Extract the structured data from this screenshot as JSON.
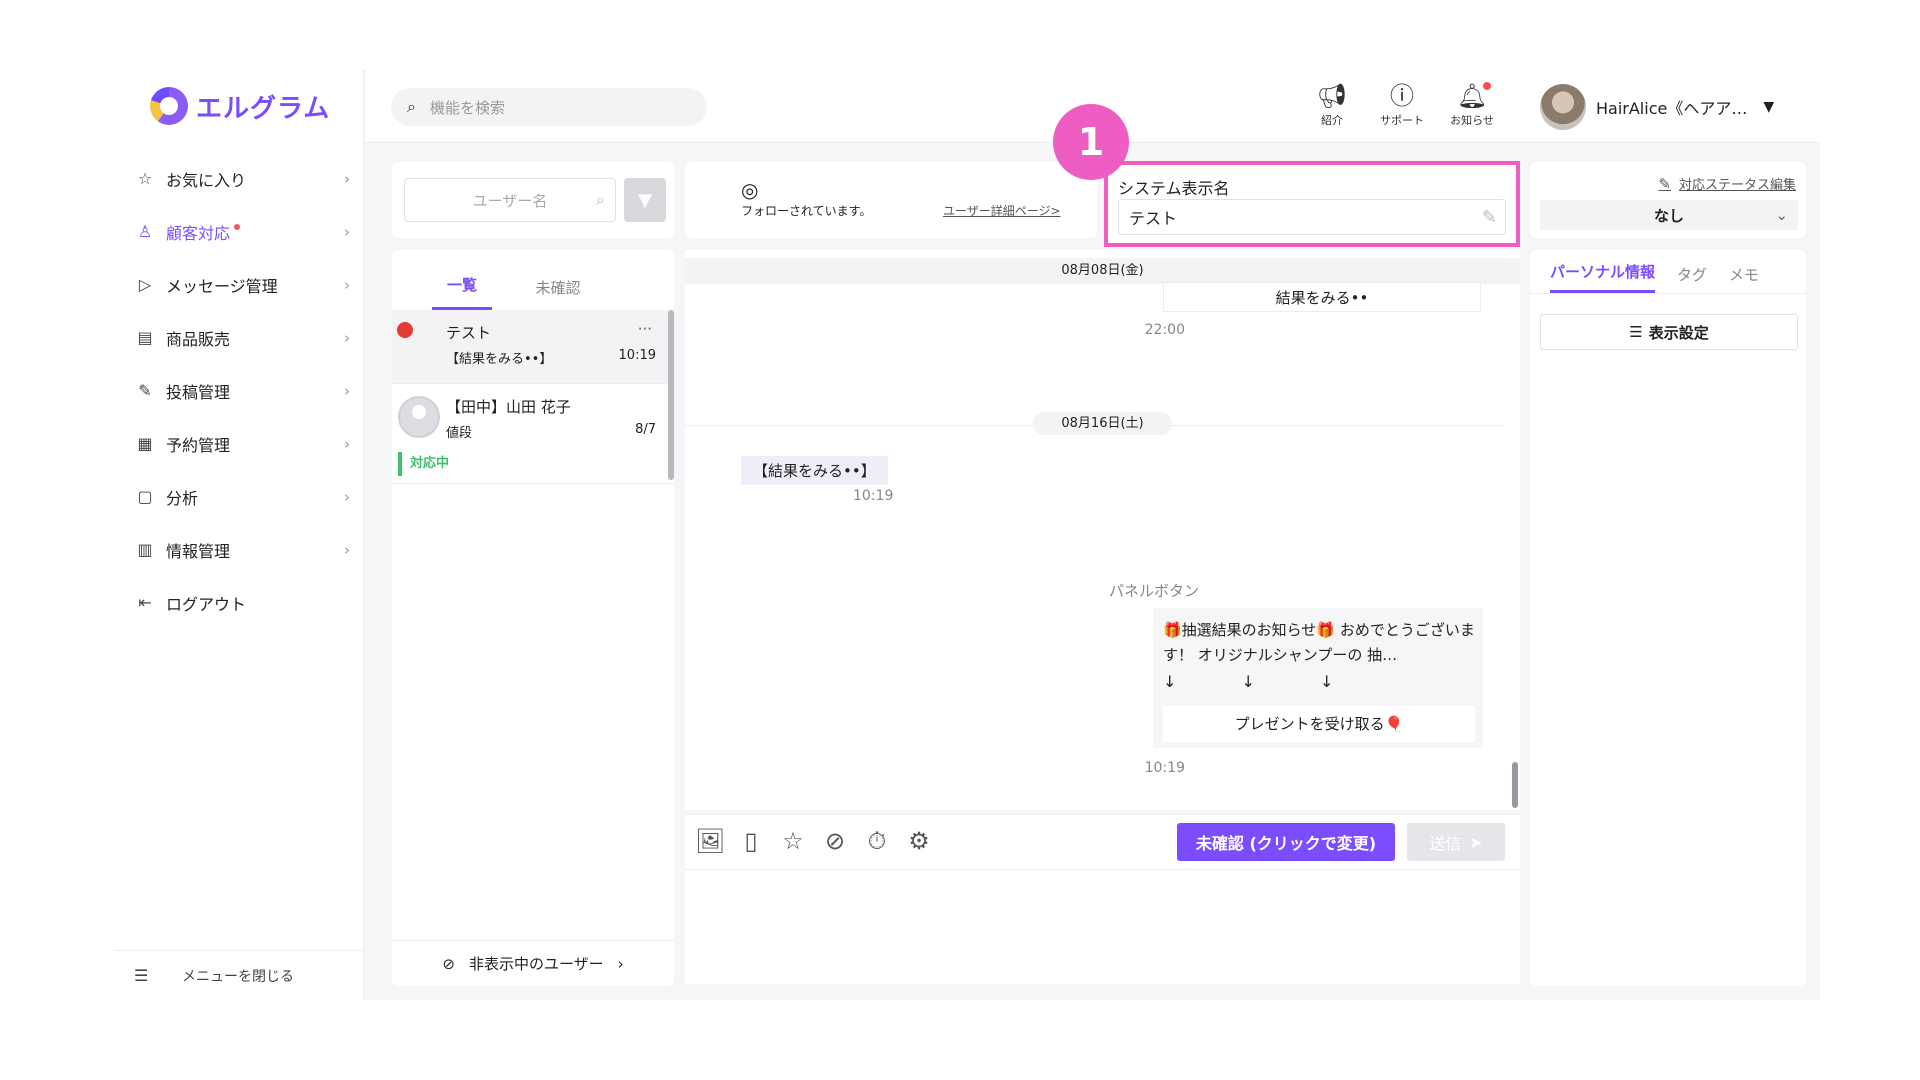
{
  "app": {
    "logo_text": "エルグラム",
    "accent_color": "#7c4dff",
    "highlight_color": "#ee5ec2"
  },
  "sidebar": {
    "items": [
      {
        "label": "お気に入り",
        "icon": "star-icon"
      },
      {
        "label": "顧客対応",
        "icon": "person-icon",
        "active": true,
        "has_dot": true
      },
      {
        "label": "メッセージ管理",
        "icon": "send-icon"
      },
      {
        "label": "商品販売",
        "icon": "shop-icon"
      },
      {
        "label": "投稿管理",
        "icon": "edit-icon"
      },
      {
        "label": "予約管理",
        "icon": "calendar-icon"
      },
      {
        "label": "分析",
        "icon": "report-icon"
      },
      {
        "label": "情報管理",
        "icon": "bar-chart-icon"
      },
      {
        "label": "ログアウト",
        "icon": "logout-icon"
      }
    ],
    "close_menu_label": "メニューを閉じる"
  },
  "header": {
    "search_placeholder": "機能を検索",
    "icons": [
      {
        "label": "紹介",
        "icon": "megaphone-icon"
      },
      {
        "label": "サポート",
        "icon": "help-icon"
      },
      {
        "label": "お知らせ",
        "icon": "bell-icon",
        "has_dot": true
      }
    ],
    "user_name": "HairAlice《ヘアア…"
  },
  "conversation_list": {
    "search_placeholder": "ユーザー名",
    "tabs": [
      "一覧",
      "未確認"
    ],
    "items": [
      {
        "name": "テスト",
        "message": "【結果をみる••】",
        "time": "10:19",
        "more": "···"
      },
      {
        "name": "【田中】山田 花子",
        "message": "値段",
        "time": "8/7",
        "status": "対応中"
      }
    ],
    "hidden_users_label": "非表示中のユーザー"
  },
  "chat_header": {
    "following_text": "フォローされています。",
    "user_detail_link": "ユーザー詳細ページ>",
    "system_name_label": "システム表示名",
    "system_name_value": "テスト",
    "callout_number": "1"
  },
  "chat": {
    "date_1": "08月08日(金)",
    "msg_1": "結果をみる••",
    "time_1": "22:00",
    "date_2": "08月16日(土)",
    "msg_in": "【結果をみる••】",
    "time_in": "10:19",
    "panel_label": "パネルボタン",
    "panel_text": "🎁抽選結果のお知らせ🎁 おめでとうございます！ オリジナルシャンプーの 抽…",
    "panel_arrows": "↓ ↓ ↓",
    "panel_button": "プレゼントを受け取る🎈",
    "time_panel": "10:19"
  },
  "composer": {
    "unconfirmed_button": "未確認 (クリックで変更)",
    "send_button": "送信"
  },
  "right_panel": {
    "status_edit_link": "対応ステータス編集",
    "status_value": "なし",
    "tabs": [
      "パーソナル情報",
      "タグ",
      "メモ"
    ],
    "display_settings_label": "表示設定"
  }
}
